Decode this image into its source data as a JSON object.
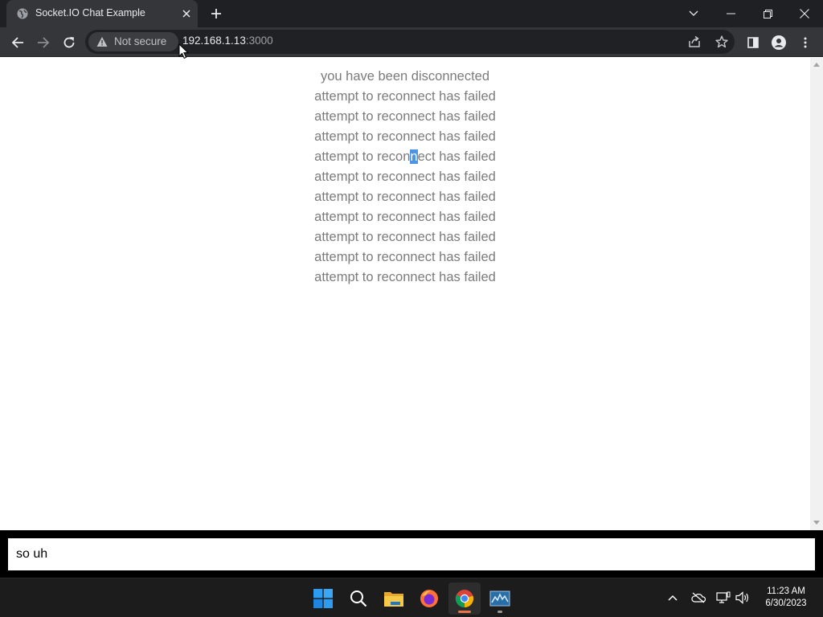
{
  "browser": {
    "tab_title": "Socket.IO Chat Example",
    "security_label": "Not secure",
    "url_host": "192.168.1.13",
    "url_port": ":3000"
  },
  "messages": [
    "you have been disconnected",
    "attempt to reconnect has failed",
    "attempt to reconnect has failed",
    "attempt to reconnect has failed",
    "attempt to reconnect has failed",
    "attempt to reconnect has failed",
    "attempt to reconnect has failed",
    "attempt to reconnect has failed",
    "attempt to reconnect has failed",
    "attempt to reconnect has failed",
    "attempt to reconnect has failed"
  ],
  "selected_message": {
    "before": "attempt to recon",
    "selected": "n",
    "after": "ect has failed"
  },
  "chat_input": {
    "value": "so uh"
  },
  "taskbar": {
    "time": "11:23 AM",
    "date": "6/30/2023"
  },
  "colors": {
    "chrome_dark": "#1f2023",
    "chrome_toolbar": "#35363a",
    "message_text": "#7b7b7b",
    "selection": "#4c94e4",
    "chrome_indicator": "#e8744a"
  }
}
